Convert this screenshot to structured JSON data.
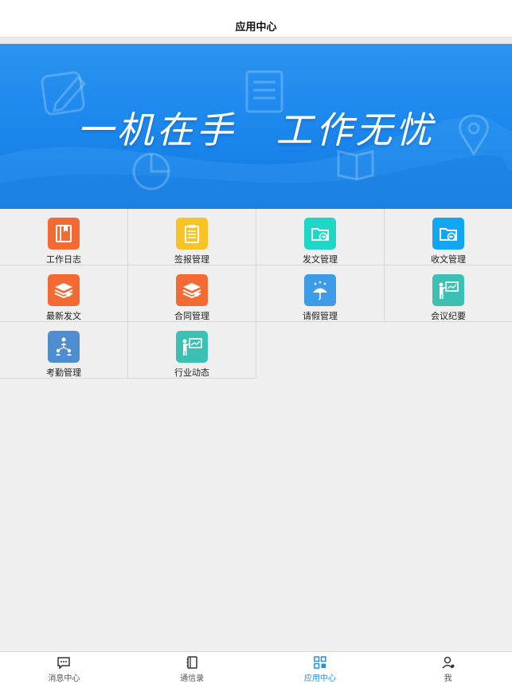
{
  "header": {
    "title": "应用中心"
  },
  "banner": {
    "slogan": "一机在手　工作无忧"
  },
  "apps": [
    {
      "label": "工作日志",
      "icon": "work-log-icon",
      "color": "#f36a33"
    },
    {
      "label": "签报管理",
      "icon": "clipboard-icon",
      "color": "#f7c325"
    },
    {
      "label": "发文管理",
      "icon": "folder-out-icon",
      "color": "#1ed7c7"
    },
    {
      "label": "收文管理",
      "icon": "folder-in-icon",
      "color": "#10a6f2"
    },
    {
      "label": "最新发文",
      "icon": "document-stack-icon",
      "color": "#f36a33"
    },
    {
      "label": "合同管理",
      "icon": "contract-stack-icon",
      "color": "#f36a33"
    },
    {
      "label": "请假管理",
      "icon": "umbrella-rain-icon",
      "color": "#3d9be8"
    },
    {
      "label": "会议纪要",
      "icon": "presentation-icon",
      "color": "#3cc0b3"
    },
    {
      "label": "考勤管理",
      "icon": "org-chart-icon",
      "color": "#4e8ed0"
    },
    {
      "label": "行业动态",
      "icon": "presentation-icon",
      "color": "#3cc0b3"
    }
  ],
  "tabbar": {
    "active_color": "#1e90e6",
    "items": [
      {
        "label": "消息中心",
        "icon": "message-icon"
      },
      {
        "label": "通信录",
        "icon": "contacts-book-icon"
      },
      {
        "label": "应用中心",
        "icon": "apps-grid-icon"
      },
      {
        "label": "我",
        "icon": "user-icon"
      }
    ]
  }
}
